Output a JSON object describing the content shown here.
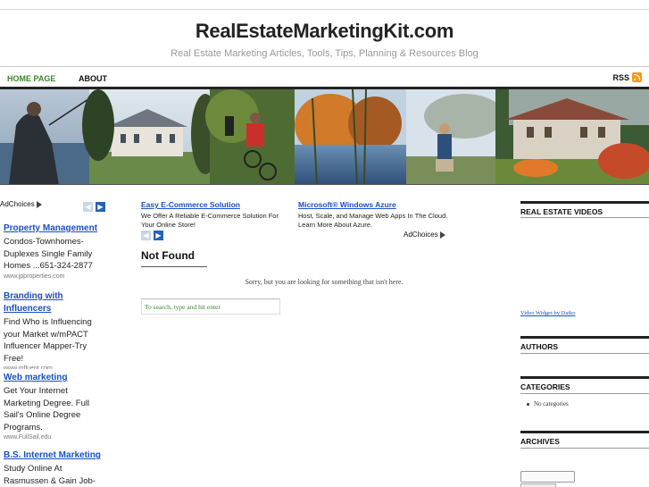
{
  "header": {
    "site_title": "RealEstateMarketingKit.com",
    "tagline": "Real Estate Marketing Articles, Tools, Tips, Planning & Resources Blog"
  },
  "nav": {
    "home": "HOME PAGE",
    "about": "ABOUT",
    "rss": "RSS",
    "home_color": "#3a8a2a"
  },
  "left_ads": {
    "adchoices": "AdChoices",
    "items": [
      {
        "title": "Property Management",
        "body": "Condos-Townhomes-Duplexes Single Family Homes ...651-324-2877",
        "url": "www.jpproperties.com"
      },
      {
        "title": "Branding with Influencers",
        "body": "Find Who is Influencing your Market w/mPACT Influencer Mapper-Try Free!",
        "url": "www.mfluent.com"
      },
      {
        "title": "Web marketing",
        "body": "Get Your Internet Marketing Degree. Full Sail's Online Degree Programs.",
        "url": "www.FullSail.edu"
      },
      {
        "title": "B.S. Internet Marketing",
        "body": "Study Online At Rasmussen & Gain Job-",
        "url": ""
      }
    ]
  },
  "top_ads": {
    "items": [
      {
        "title": "Easy E-Commerce Solution",
        "body": "We Offer A Reliable E-Commerce Solution For Your Online Store!"
      },
      {
        "title": "Microsoft® Windows Azure",
        "body": "Host, Scale, and Manage Web Apps In The Cloud. Learn More About Azure."
      }
    ],
    "adchoices": "AdChoices"
  },
  "main": {
    "title": "Not Found",
    "message": "Sorry, but you are looking for something that isn't here.",
    "search_placeholder": "To search, type and hit enter"
  },
  "sidebar": {
    "videos_title": "REAL ESTATE VIDEOS",
    "video_link": "Video Widget by Daiko",
    "authors_title": "AUTHORS",
    "categories_title": "CATEGORIES",
    "no_categories": "No categories",
    "archives_title": "ARCHIVES"
  },
  "colors": {
    "link": "#1a4fc4",
    "rss": "#f39a1d",
    "accent_green": "#3a8a2a"
  }
}
